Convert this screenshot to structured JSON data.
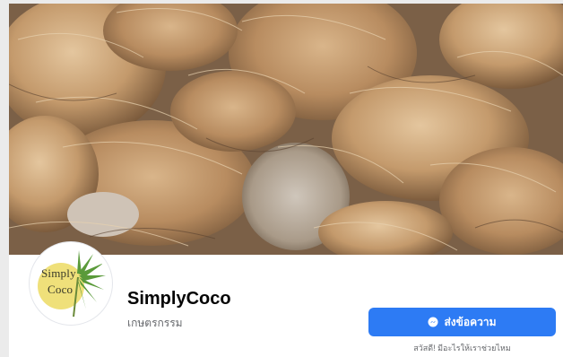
{
  "page": {
    "name": "SimplyCoco",
    "category": "เกษตรกรรม",
    "profile_logo": {
      "line1": "Simply",
      "line2": "Coco"
    }
  },
  "actions": {
    "message_button_label": "ส่งข้อความ",
    "message_icon": "messenger-icon",
    "greeting_text": "สวัสดี! มีอะไรให้เราช่วยไหม"
  },
  "colors": {
    "primary_button": "#2d7bf4",
    "logo_circle": "#efe07a",
    "logo_palm": "#5a9a3a"
  }
}
